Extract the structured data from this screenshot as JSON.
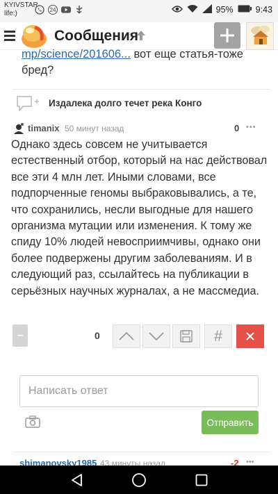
{
  "status_bar": {
    "carrier_line1": "KYIVSTAR",
    "carrier_line2": "life:)",
    "badge_number": "24",
    "battery": "95%",
    "time": "9:43"
  },
  "header": {
    "title": "Сообщения"
  },
  "content": {
    "top_link_text": "mp/science/201606...",
    "top_link_tail": " вот еще статья-тоже",
    "top_line2": "бред?",
    "related_title": "Издалека долго течет река Конго"
  },
  "comment": {
    "username": "timanix",
    "time_ago": "50 минут назад",
    "rating": "0",
    "more": "•••",
    "body": "Однако здесь совсем не учитывается естественный отбор, который на нас действовал все эти 4 млн лет. Иными словами, все подпорченные геномы выбраковывались, а те, что сохранились, несли выгодные для нашего организма мутации или изменения. К тому же спиду 10% людей невосприимчивы, однако они более подвержены другим заболеваниям. И в следующий раз, ссылайтесь на публикации в серьёзных научных журналах, а не массмедиа."
  },
  "actions": {
    "minus": "–",
    "rating": "0",
    "hash": "#"
  },
  "reply": {
    "placeholder": "Написать ответ",
    "send_label": "Отправить"
  },
  "next_comment": {
    "username": "shimanovsky1985",
    "time_ago": "43 минуты назад",
    "rating": "-2",
    "more": "•••"
  },
  "colors": {
    "accent_green": "#78bd5a",
    "close_red": "#e55048",
    "link_blue": "#2a6aab"
  }
}
